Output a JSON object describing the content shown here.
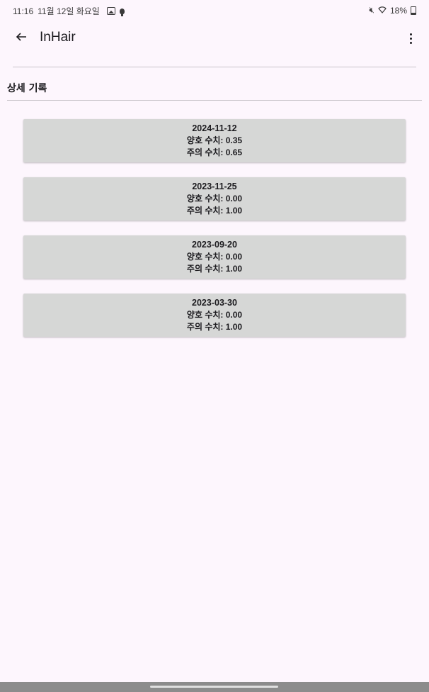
{
  "status_bar": {
    "time": "11:16",
    "date": "11월 12일 화요일",
    "battery": "18%"
  },
  "app_bar": {
    "title": "InHair"
  },
  "section": {
    "title": "상세 기록"
  },
  "records": [
    {
      "date": "2024-11-12",
      "good": "양호 수치: 0.35",
      "caution": "주의 수치: 0.65"
    },
    {
      "date": "2023-11-25",
      "good": "양호 수치: 0.00",
      "caution": "주의 수치: 1.00"
    },
    {
      "date": "2023-09-20",
      "good": "양호 수치: 0.00",
      "caution": "주의 수치: 1.00"
    },
    {
      "date": "2023-03-30",
      "good": "양호 수치: 0.00",
      "caution": "주의 수치: 1.00"
    }
  ],
  "icons": {
    "back": "arrow-back-icon",
    "more": "more-vert-icon",
    "gallery": "gallery-icon",
    "bulb": "bulb-icon",
    "mute": "mute-icon",
    "wifi": "wifi-icon",
    "battery": "battery-icon"
  },
  "colors": {
    "background": "#fdf6fd",
    "card": "#d6d7d6",
    "divider": "#c8c4c9",
    "nav_bar": "#8c8c8c"
  }
}
